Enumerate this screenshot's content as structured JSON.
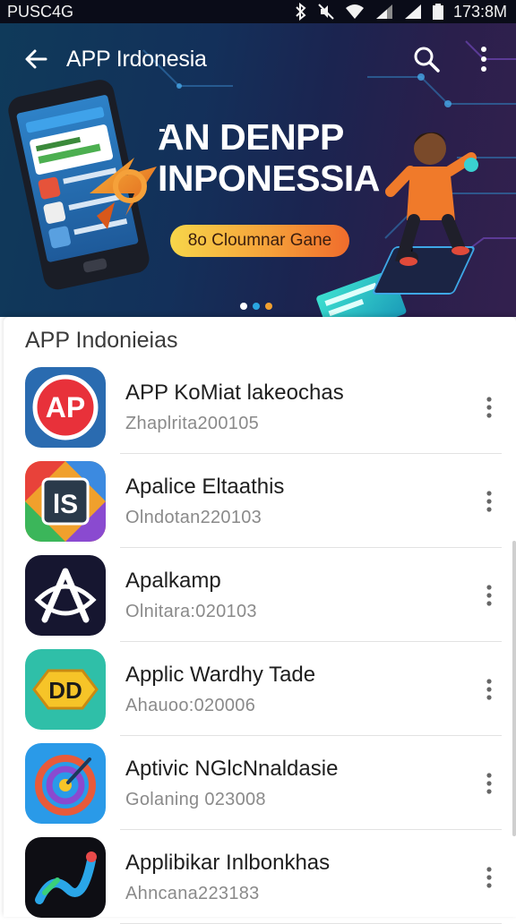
{
  "status_bar": {
    "carrier": "PUSC4G",
    "time": "173:8M",
    "icons": [
      "bluetooth-icon",
      "mute-icon",
      "wifi-icon",
      "signal-icon",
      "signal-icon",
      "battery-icon"
    ]
  },
  "header": {
    "title": "APP Irdonesia",
    "back_icon": "arrow-left-icon",
    "search_icon": "search-icon",
    "more_icon": "more-vertical-icon"
  },
  "banner": {
    "headline_line1": "AN DENPP",
    "headline_line2": "INPONESSIA",
    "pill_text": "8o Cloumnar Gane",
    "carousel_pages": 3,
    "carousel_active_index": 1,
    "dot_colors": [
      "#ffffff",
      "#2aa6e0",
      "#f0a030"
    ]
  },
  "section": {
    "title": "APP Indonieias"
  },
  "apps": [
    {
      "name": "APP KoMiat lakeochas",
      "subtitle": "Zhaplrita200105",
      "icon": "ap-logo-icon",
      "icon_text": "AP"
    },
    {
      "name": "Apalice Eltaathis",
      "subtitle": "Olndotan220103",
      "icon": "is-logo-icon",
      "icon_text": "lS"
    },
    {
      "name": "Apalkamp",
      "subtitle": "Olnitara:020103",
      "icon": "a-logo-icon"
    },
    {
      "name": "Applic Wardhy Tade",
      "subtitle": "Ahauoo:020006",
      "icon": "dd-logo-icon",
      "icon_text": "DD"
    },
    {
      "name": "Aptivic NGlcNnaldasie",
      "subtitle": "Golaning 023008",
      "icon": "target-logo-icon"
    },
    {
      "name": "Applibikar Inlbonkhas",
      "subtitle": "Ahncana223183",
      "icon": "swirl-logo-icon"
    }
  ],
  "row_menu_icon": "more-vertical-icon"
}
